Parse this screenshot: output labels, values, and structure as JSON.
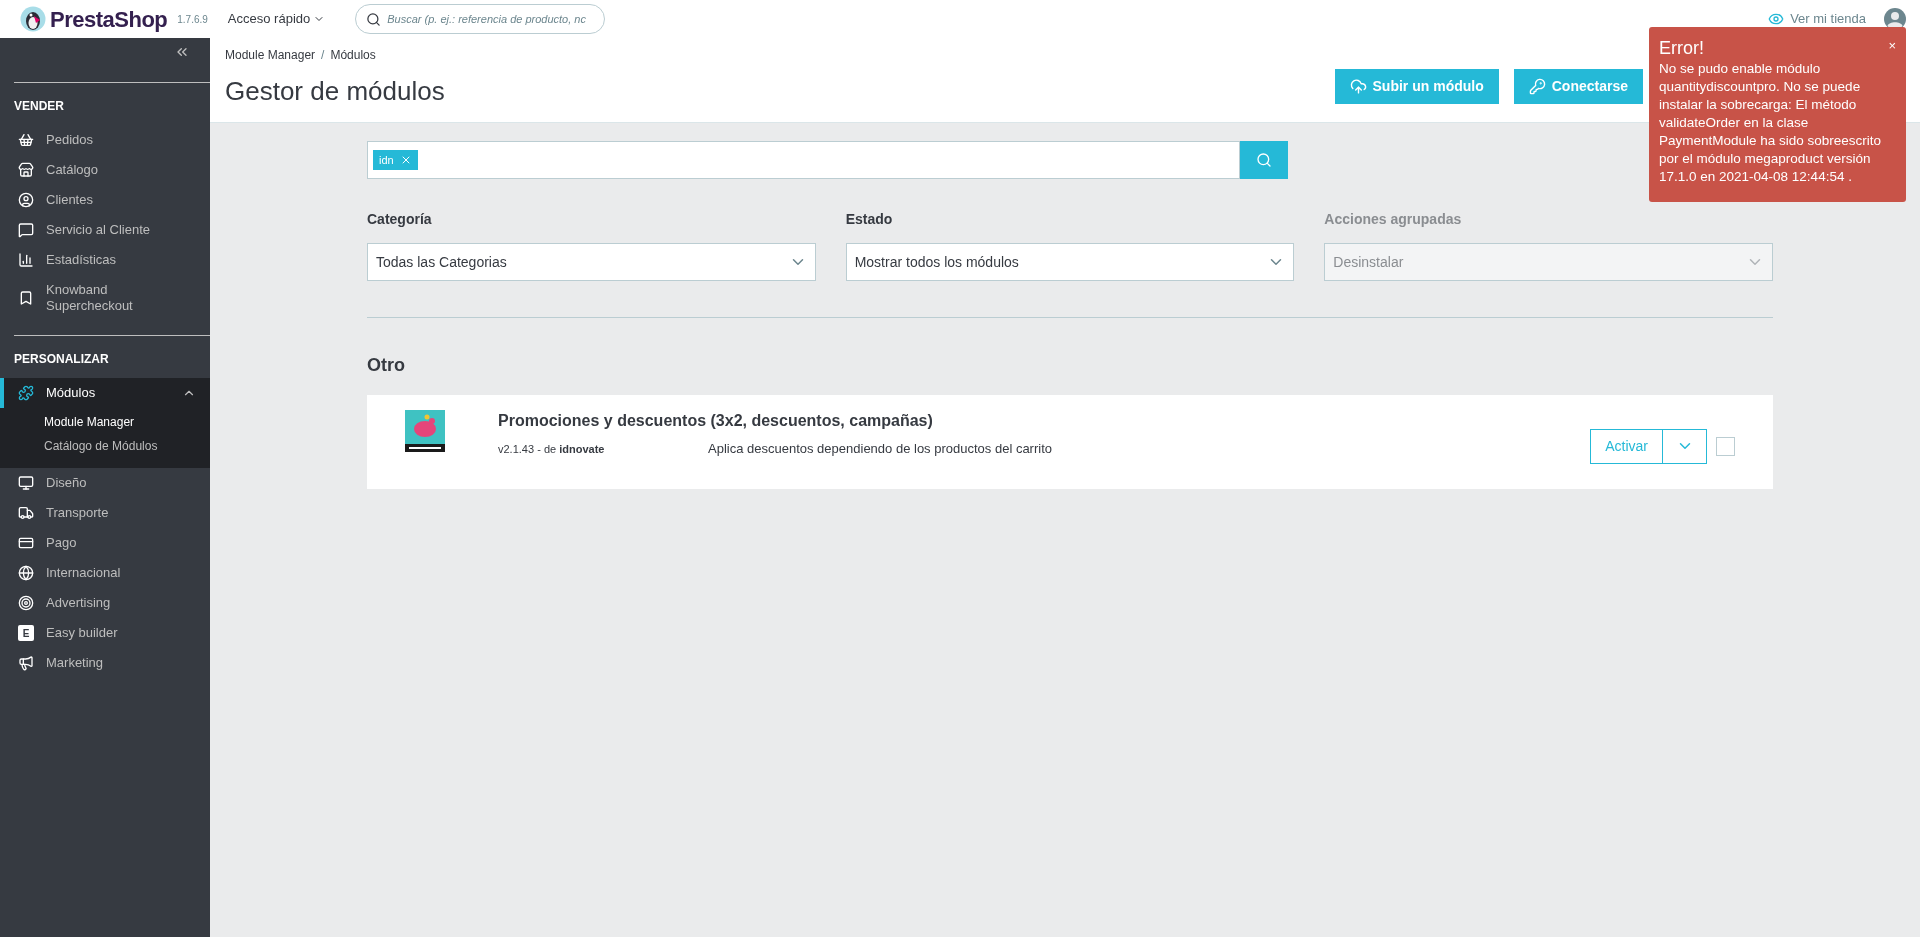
{
  "header": {
    "brand": "PrestaShop",
    "version": "1.7.6.9",
    "quick_access": "Acceso rápido",
    "search": {
      "placeholder": "Buscar (p. ej.: referencia de producto, nc"
    },
    "store_link": "Ver mi tienda"
  },
  "sidebar": {
    "sections": [
      {
        "title": "VENDER",
        "items": [
          {
            "label": "Pedidos",
            "selected": false
          },
          {
            "label": "Catálogo",
            "selected": false
          },
          {
            "label": "Clientes",
            "selected": false
          },
          {
            "label": "Servicio al Cliente",
            "selected": false
          },
          {
            "label": "Estadísticas",
            "selected": false
          },
          {
            "label": "Knowband Supercheckout",
            "selected": false
          }
        ]
      },
      {
        "title": "PERSONALIZAR",
        "items": [
          {
            "label": "Módulos",
            "selected": true,
            "expanded": true,
            "children": [
              {
                "label": "Module Manager",
                "selected": true
              },
              {
                "label": "Catálogo de Módulos",
                "selected": false
              }
            ]
          },
          {
            "label": "Diseño",
            "selected": false
          },
          {
            "label": "Transporte",
            "selected": false
          },
          {
            "label": "Pago",
            "selected": false
          },
          {
            "label": "Internacional",
            "selected": false
          },
          {
            "label": "Advertising",
            "selected": false
          },
          {
            "label": "Easy builder",
            "selected": false,
            "icon_letter": "E"
          },
          {
            "label": "Marketing",
            "selected": false
          }
        ]
      }
    ]
  },
  "breadcrumb": [
    "Module Manager",
    "Módulos"
  ],
  "breadcrumb_separator": "/",
  "page_title": "Gestor de módulos",
  "toolbar": [
    {
      "label": "Subir un módulo",
      "kind": "upload"
    },
    {
      "label": "Conectarse",
      "kind": "key"
    }
  ],
  "filter": {
    "tags": [
      "idn"
    ]
  },
  "selects": [
    {
      "label": "Categoría",
      "value": "Todas las Categorias",
      "disabled": false
    },
    {
      "label": "Estado",
      "value": "Mostrar todos los módulos",
      "disabled": false
    },
    {
      "label": "Acciones agrupadas",
      "value": "Desinstalar",
      "disabled": true
    }
  ],
  "group_title": "Otro",
  "modules": [
    {
      "name": "Promociones y descuentos (3x2, descuentos, campañas)",
      "version": "v2.1.43",
      "separator": "-",
      "by": "de",
      "author": "idnovate",
      "description": "Aplica descuentos dependiendo de los productos del carrito",
      "action": "Activar",
      "checked": false
    }
  ],
  "toast": {
    "title": "Error!",
    "message": "No se pudo enable módulo quantitydiscountpro. No se puede instalar la sobrecarga: El método validateOrder en la clase PaymentModule ha sido sobreescrito por el módulo megaproduct versión 17.1.0 en 2021-04-08 12:44:54 .",
    "close": "×"
  }
}
